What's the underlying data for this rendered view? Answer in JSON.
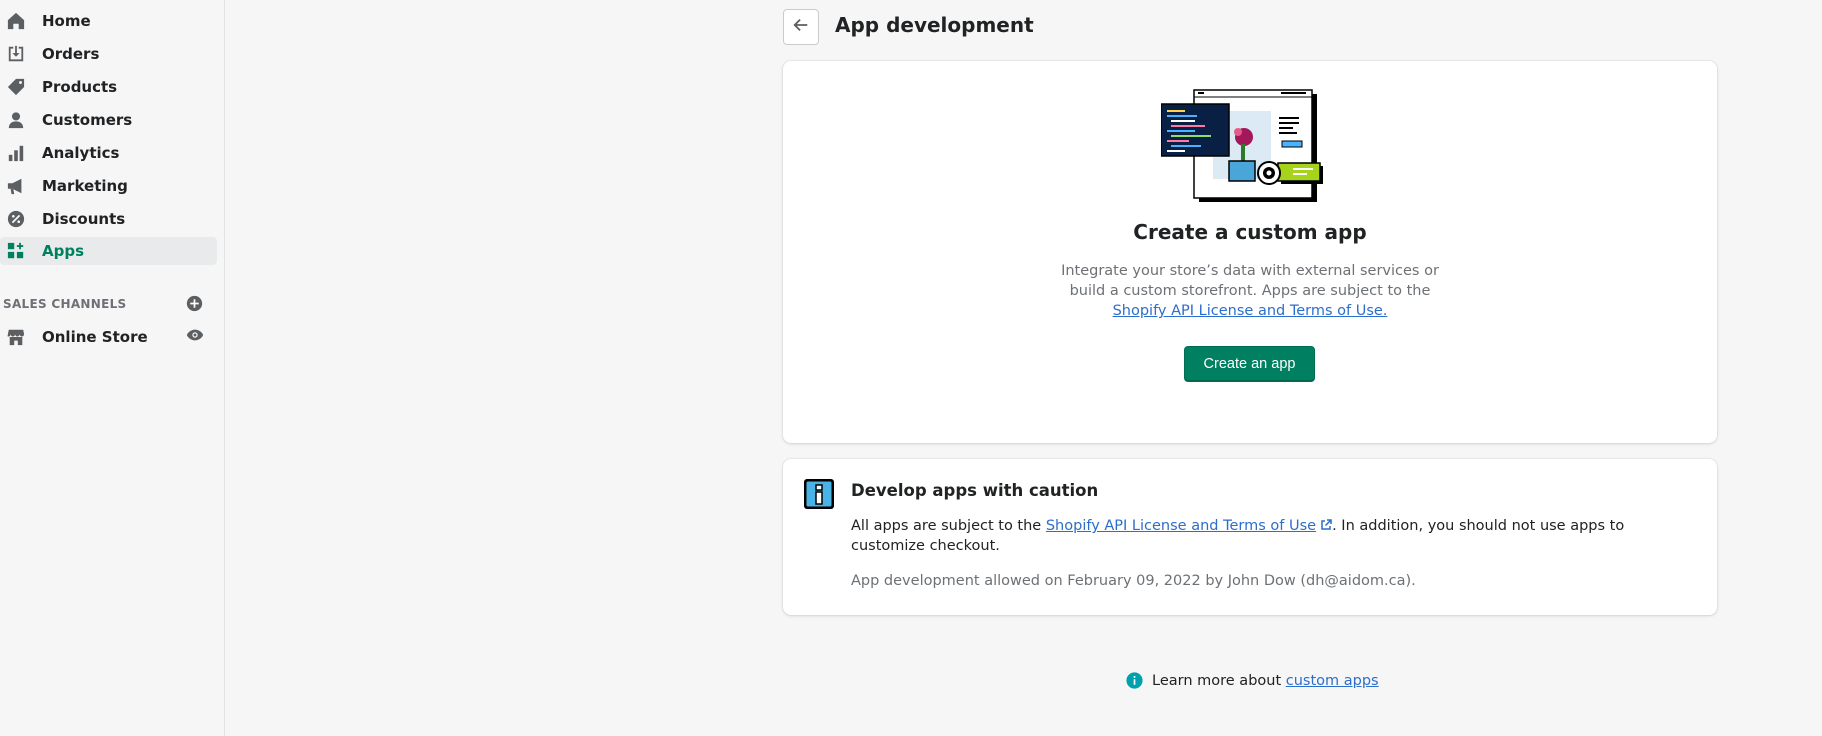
{
  "sidebar": {
    "items": [
      {
        "label": "Home",
        "icon": "home-icon"
      },
      {
        "label": "Orders",
        "icon": "orders-icon"
      },
      {
        "label": "Products",
        "icon": "tag-icon"
      },
      {
        "label": "Customers",
        "icon": "person-icon"
      },
      {
        "label": "Analytics",
        "icon": "bar-chart-icon"
      },
      {
        "label": "Marketing",
        "icon": "megaphone-icon"
      },
      {
        "label": "Discounts",
        "icon": "discount-icon"
      },
      {
        "label": "Apps",
        "icon": "apps-icon",
        "active": true
      }
    ],
    "sales_channels_title": "SALES CHANNELS",
    "channels": [
      {
        "label": "Online Store",
        "icon": "store-icon"
      }
    ]
  },
  "header": {
    "title": "App development"
  },
  "custom_app_card": {
    "heading": "Create a custom app",
    "desc_line1": "Integrate your store’s data with external services or",
    "desc_line2": "build a custom storefront. Apps are subject to the",
    "license_link": "Shopify API License and Terms of Use.",
    "button_label": "Create an app"
  },
  "caution_card": {
    "title": "Develop apps with caution",
    "text_before": "All apps are subject to the",
    "link_text": "Shopify API License and Terms of Use",
    "text_after": ". In addition, you should not use apps to customize checkout.",
    "allowed_text": "App development allowed on February 09, 2022 by John Dow (dh@aidom.ca)."
  },
  "learn_more": {
    "prefix": "Learn more about",
    "link_text": "custom apps"
  },
  "colors": {
    "accent": "#008060",
    "link": "#2c6ecb",
    "info": "#00a0ac"
  }
}
